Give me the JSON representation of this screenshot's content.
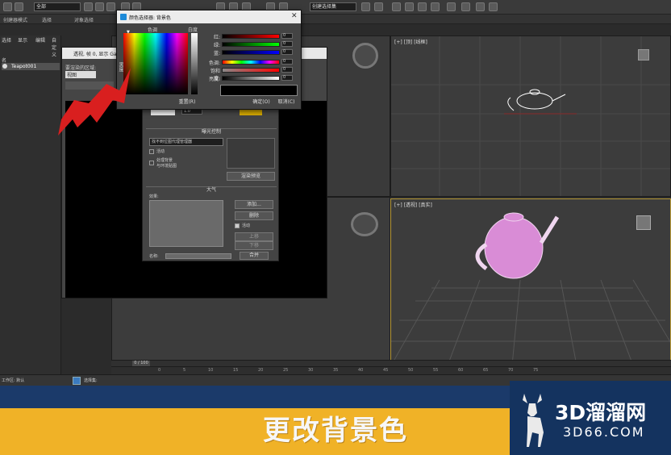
{
  "toolbar": {
    "filter_select": "全部",
    "view_select": "创建选择集"
  },
  "menubar": {
    "items": [
      "创建器模式",
      "选择",
      "对象选择"
    ]
  },
  "left_panel": {
    "menu": [
      "选择",
      "显示",
      "编辑",
      "自定义"
    ],
    "tree_header": "名",
    "tree_item": "Teapot001"
  },
  "viewports": {
    "top_right": "[+] [顶] [线框]",
    "bottom_right": "[+] [透视] [真实]"
  },
  "render_window": {
    "title": "透视, 帧 0, 显示 Gam",
    "area_label": "要渲染的区域:",
    "area_value": "视图"
  },
  "env_dialog": {
    "exposure_header": "曝光控制",
    "exposure_select": "找不到位图代理管理器",
    "active_label": "活动",
    "process_bg_label": "处理背景",
    "process_bg_label2": "与环境贴图",
    "render_preview": "渲染预览",
    "atmosphere_header": "大气",
    "effects_label": "效果:",
    "add_button": "添加...",
    "delete_button": "删除",
    "active2_label": "活动",
    "up_button": "上移",
    "down_button": "下移",
    "name_label": "名称:",
    "merge_button": "合并",
    "bg_value": "1.0"
  },
  "color_picker": {
    "title": "颜色选择器: 背景色",
    "hue_label": "色调",
    "whiteness_label": "白度",
    "black_label": "黑度",
    "sliders": [
      {
        "label": "红:",
        "value": "0"
      },
      {
        "label": "绿:",
        "value": "0"
      },
      {
        "label": "蓝:",
        "value": "0"
      },
      {
        "label": "色调:",
        "value": "0"
      },
      {
        "label": "饱和度:",
        "value": "0"
      },
      {
        "label": "亮度:",
        "value": "0"
      }
    ],
    "reset_button": "重置(R)",
    "ok_button": "确定(O)",
    "cancel_button": "取消(C)"
  },
  "timeline": {
    "frame_counter": "0 / 100",
    "ticks": [
      "0",
      "5",
      "10",
      "15",
      "20",
      "25",
      "30",
      "35",
      "40",
      "45",
      "50",
      "55",
      "60",
      "65",
      "70",
      "75"
    ]
  },
  "status_bar": {
    "workspace": "工作区: 默认",
    "selection_set": "选择集:"
  },
  "caption": "更改背景色",
  "logo": {
    "main": "3D溜溜网",
    "sub": "3D66.COM"
  }
}
